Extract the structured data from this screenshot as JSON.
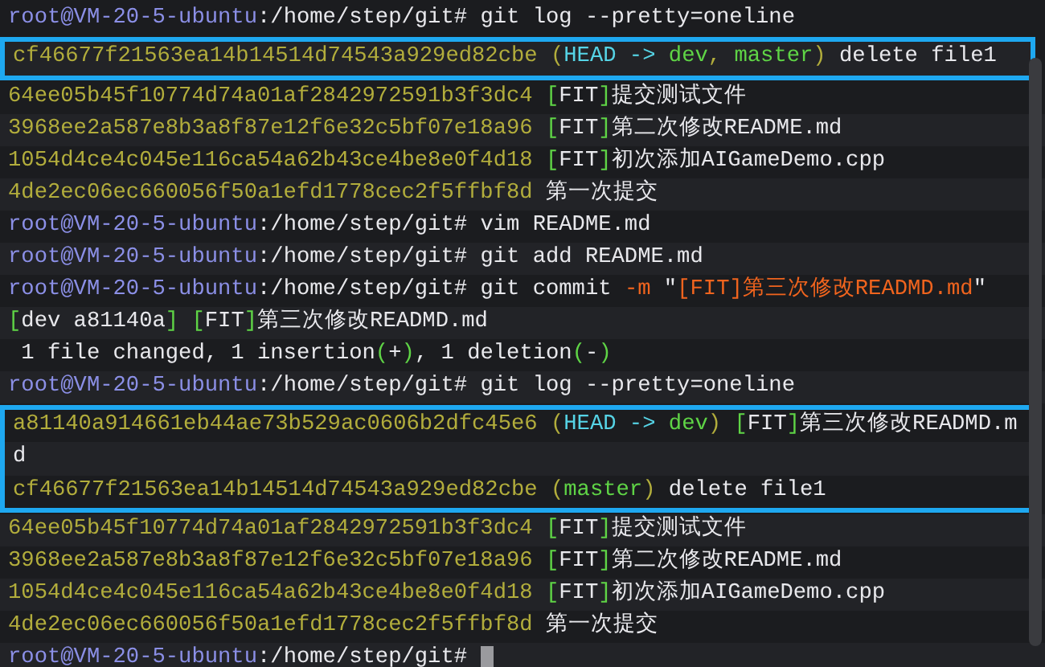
{
  "lines": [
    {
      "highlighted": false,
      "segments": [
        {
          "kind": "user",
          "text": "root@VM-20-5-ubuntu"
        },
        {
          "kind": "path",
          "text": ":/home/step/git#"
        },
        {
          "kind": "plain",
          "text": " git log --pretty=oneline"
        }
      ]
    },
    {
      "highlighted": true,
      "segments": [
        {
          "kind": "hash",
          "text": "cf46677f21563ea14b14514d74543a929ed82cbe"
        },
        {
          "kind": "paren",
          "text": " ("
        },
        {
          "kind": "head",
          "text": "HEAD -> "
        },
        {
          "kind": "branch",
          "text": "dev"
        },
        {
          "kind": "paren",
          "text": ", "
        },
        {
          "kind": "branch",
          "text": "master"
        },
        {
          "kind": "paren",
          "text": ")"
        },
        {
          "kind": "plain",
          "text": " delete file1"
        }
      ]
    },
    {
      "highlighted": false,
      "segments": [
        {
          "kind": "hash",
          "text": "64ee05b45f10774d74a01af2842972591b3f3dc4"
        },
        {
          "kind": "bracket",
          "text": " ["
        },
        {
          "kind": "plain",
          "text": "FIT"
        },
        {
          "kind": "bracket",
          "text": "]"
        },
        {
          "kind": "plain",
          "text": "提交测试文件"
        }
      ]
    },
    {
      "highlighted": false,
      "segments": [
        {
          "kind": "hash",
          "text": "3968ee2a587e8b3a8f87e12f6e32c5bf07e18a96"
        },
        {
          "kind": "bracket",
          "text": " ["
        },
        {
          "kind": "plain",
          "text": "FIT"
        },
        {
          "kind": "bracket",
          "text": "]"
        },
        {
          "kind": "plain",
          "text": "第二次修改README.md"
        }
      ]
    },
    {
      "highlighted": false,
      "segments": [
        {
          "kind": "hash",
          "text": "1054d4ce4c045e116ca54a62b43ce4be8e0f4d18"
        },
        {
          "kind": "bracket",
          "text": " ["
        },
        {
          "kind": "plain",
          "text": "FIT"
        },
        {
          "kind": "bracket",
          "text": "]"
        },
        {
          "kind": "plain",
          "text": "初次添加AIGameDemo.cpp"
        }
      ]
    },
    {
      "highlighted": false,
      "segments": [
        {
          "kind": "hash",
          "text": "4de2ec06ec660056f50a1efd1778cec2f5ffbf8d"
        },
        {
          "kind": "plain",
          "text": " 第一次提交"
        }
      ]
    },
    {
      "highlighted": false,
      "segments": [
        {
          "kind": "user",
          "text": "root@VM-20-5-ubuntu"
        },
        {
          "kind": "path",
          "text": ":/home/step/git#"
        },
        {
          "kind": "plain",
          "text": " vim README.md"
        }
      ]
    },
    {
      "highlighted": false,
      "segments": [
        {
          "kind": "user",
          "text": "root@VM-20-5-ubuntu"
        },
        {
          "kind": "path",
          "text": ":/home/step/git#"
        },
        {
          "kind": "plain",
          "text": " git add README.md"
        }
      ]
    },
    {
      "highlighted": false,
      "segments": [
        {
          "kind": "user",
          "text": "root@VM-20-5-ubuntu"
        },
        {
          "kind": "path",
          "text": ":/home/step/git#"
        },
        {
          "kind": "plain",
          "text": " git commit "
        },
        {
          "kind": "flag",
          "text": "-m"
        },
        {
          "kind": "plain",
          "text": " \""
        },
        {
          "kind": "flag",
          "text": "[FIT]第三次修改READMD.md"
        },
        {
          "kind": "plain",
          "text": "\""
        }
      ]
    },
    {
      "highlighted": false,
      "segments": [
        {
          "kind": "bracket",
          "text": "["
        },
        {
          "kind": "plain",
          "text": "dev a81140a"
        },
        {
          "kind": "bracket",
          "text": "] ["
        },
        {
          "kind": "plain",
          "text": "FIT"
        },
        {
          "kind": "bracket",
          "text": "]"
        },
        {
          "kind": "plain",
          "text": "第三次修改READMD.md"
        }
      ]
    },
    {
      "highlighted": false,
      "segments": [
        {
          "kind": "plain",
          "text": " 1 file changed, 1 insertion"
        },
        {
          "kind": "bracket",
          "text": "("
        },
        {
          "kind": "plain",
          "text": "+"
        },
        {
          "kind": "bracket",
          "text": ")"
        },
        {
          "kind": "plain",
          "text": ", 1 deletion"
        },
        {
          "kind": "bracket",
          "text": "("
        },
        {
          "kind": "plain",
          "text": "-"
        },
        {
          "kind": "bracket",
          "text": ")"
        }
      ]
    },
    {
      "highlighted": false,
      "segments": [
        {
          "kind": "user",
          "text": "root@VM-20-5-ubuntu"
        },
        {
          "kind": "path",
          "text": ":/home/step/git#"
        },
        {
          "kind": "plain",
          "text": " git log --pretty=oneline"
        }
      ]
    },
    {
      "highlighted": true,
      "segments": [
        {
          "kind": "hash",
          "text": "a81140a914661eb44ae73b529ac0606b2dfc45e6"
        },
        {
          "kind": "paren",
          "text": " ("
        },
        {
          "kind": "head",
          "text": "HEAD -> "
        },
        {
          "kind": "branch",
          "text": "dev"
        },
        {
          "kind": "paren",
          "text": ")"
        },
        {
          "kind": "bracket",
          "text": " ["
        },
        {
          "kind": "plain",
          "text": "FIT"
        },
        {
          "kind": "bracket",
          "text": "]"
        },
        {
          "kind": "plain",
          "text": "第三次修改READMD.m"
        }
      ]
    },
    {
      "highlighted": true,
      "segments": [
        {
          "kind": "plain",
          "text": "d"
        }
      ]
    },
    {
      "highlighted": true,
      "segments": [
        {
          "kind": "hash",
          "text": "cf46677f21563ea14b14514d74543a929ed82cbe"
        },
        {
          "kind": "paren",
          "text": " ("
        },
        {
          "kind": "branch",
          "text": "master"
        },
        {
          "kind": "paren",
          "text": ")"
        },
        {
          "kind": "plain",
          "text": " delete file1"
        }
      ]
    },
    {
      "highlighted": false,
      "segments": [
        {
          "kind": "hash",
          "text": "64ee05b45f10774d74a01af2842972591b3f3dc4"
        },
        {
          "kind": "bracket",
          "text": " ["
        },
        {
          "kind": "plain",
          "text": "FIT"
        },
        {
          "kind": "bracket",
          "text": "]"
        },
        {
          "kind": "plain",
          "text": "提交测试文件"
        }
      ]
    },
    {
      "highlighted": false,
      "segments": [
        {
          "kind": "hash",
          "text": "3968ee2a587e8b3a8f87e12f6e32c5bf07e18a96"
        },
        {
          "kind": "bracket",
          "text": " ["
        },
        {
          "kind": "plain",
          "text": "FIT"
        },
        {
          "kind": "bracket",
          "text": "]"
        },
        {
          "kind": "plain",
          "text": "第二次修改README.md"
        }
      ]
    },
    {
      "highlighted": false,
      "segments": [
        {
          "kind": "hash",
          "text": "1054d4ce4c045e116ca54a62b43ce4be8e0f4d18"
        },
        {
          "kind": "bracket",
          "text": " ["
        },
        {
          "kind": "plain",
          "text": "FIT"
        },
        {
          "kind": "bracket",
          "text": "]"
        },
        {
          "kind": "plain",
          "text": "初次添加AIGameDemo.cpp"
        }
      ]
    },
    {
      "highlighted": false,
      "segments": [
        {
          "kind": "hash",
          "text": "4de2ec06ec660056f50a1efd1778cec2f5ffbf8d"
        },
        {
          "kind": "plain",
          "text": " 第一次提交"
        }
      ]
    },
    {
      "highlighted": false,
      "cursor": true,
      "segments": [
        {
          "kind": "user",
          "text": "root@VM-20-5-ubuntu"
        },
        {
          "kind": "path",
          "text": ":/home/step/git#"
        }
      ]
    }
  ]
}
